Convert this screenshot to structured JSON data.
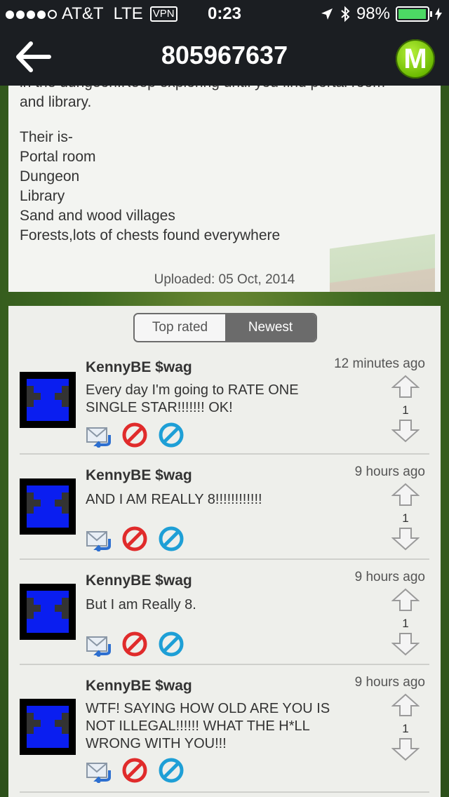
{
  "status": {
    "carrier": "AT&T",
    "network": "LTE",
    "vpn": "VPN",
    "time": "0:23",
    "battery": "98%",
    "battery_level": 0.98
  },
  "nav": {
    "title": "805967637",
    "logo_letter": "M"
  },
  "description": {
    "partial_line": "in the dungeon.Keep exploring until you find portal room",
    "line2": "and library.",
    "list": [
      "Their is-",
      "Portal room",
      "Dungeon",
      "Library",
      "Sand and wood villages",
      "Forests,lots of chests found everywhere"
    ],
    "uploaded": "Uploaded: 05 Oct, 2014"
  },
  "tabs": {
    "top_rated": "Top rated",
    "newest": "Newest",
    "selected": "Newest"
  },
  "comments": [
    {
      "author": "KennyBE $wag",
      "time": "12 minutes ago",
      "text": "Every day I'm going to RATE ONE SINGLE STAR!!!!!!! OK!",
      "votes": "1"
    },
    {
      "author": "KennyBE $wag",
      "time": "9 hours ago",
      "text": "AND I AM REALLY 8!!!!!!!!!!!!",
      "votes": "1"
    },
    {
      "author": "KennyBE $wag",
      "time": "9 hours ago",
      "text": "But I am Really 8.",
      "votes": "1"
    },
    {
      "author": "KennyBE $wag",
      "time": "9 hours ago",
      "text": "WTF! SAYING HOW OLD ARE YOU IS NOT ILLEGAL!!!!!! WHAT THE H*LL WRONG WITH YOU!!!",
      "votes": "1"
    }
  ],
  "colors": {
    "bar": "#1b1e22",
    "logo": "#6ab800",
    "avatar": "#0a1ef0",
    "block_icon": "#e02b2b",
    "flag_icon": "#1e9fd6"
  },
  "icons": {
    "back": "back-arrow-icon",
    "reply": "reply-icon",
    "block": "block-icon",
    "flag": "flag-icon",
    "up": "upvote-arrow-icon",
    "down": "downvote-arrow-icon"
  }
}
